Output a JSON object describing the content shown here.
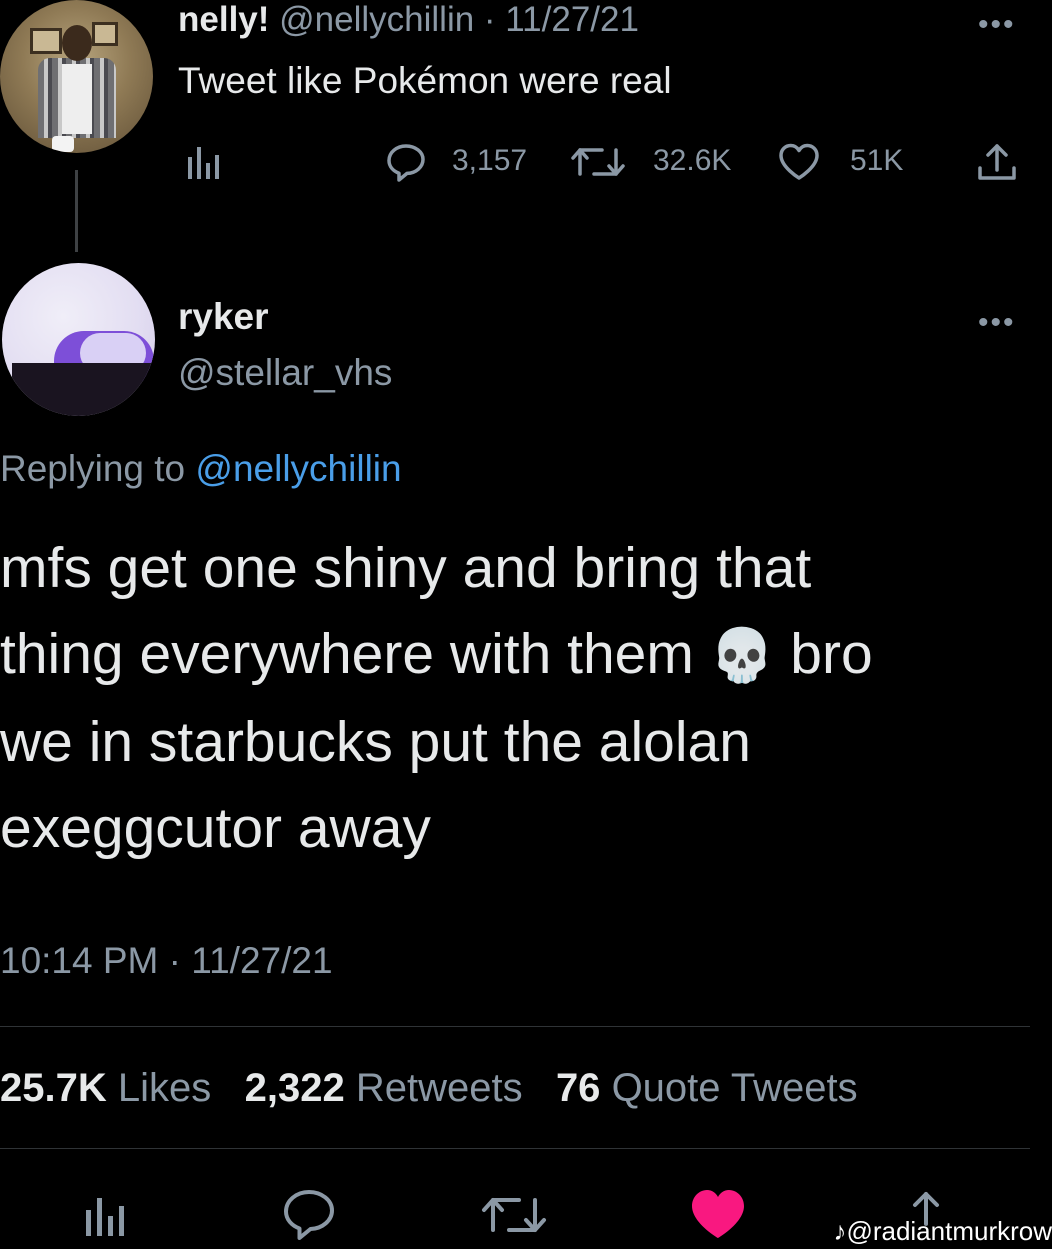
{
  "parent_tweet": {
    "display_name": "nelly!",
    "handle_date": "@nellychillin · 11/27/21",
    "text": "Tweet like Pokémon were real",
    "replies": "3,157",
    "retweets": "32.6K",
    "likes": "51K"
  },
  "reply_tweet": {
    "display_name": "ryker",
    "handle": "@stellar_vhs",
    "replying_prefix": "Replying to",
    "replying_handle": "@nellychillin",
    "text_lines": [
      "mfs get one shiny and bring that",
      "thing everywhere with them",
      "bro",
      "we in starbucks put the alolan",
      "exeggcutor away"
    ],
    "skull_emoji": "💀",
    "timestamp": "10:14 PM · 11/27/21",
    "stats": {
      "likes_count": "25.7K",
      "likes_label": "Likes",
      "retweets_count": "2,322",
      "retweets_label": "Retweets",
      "quotes_count": "76",
      "quotes_label": "Quote Tweets"
    }
  },
  "watermark": {
    "logo": "♪",
    "handle": "@radiantmurkrow"
  },
  "colors": {
    "background": "#000000",
    "text": "#e7e9ea",
    "secondary": "#8b98a5",
    "link": "#4a9ee8",
    "like_active": "#f91880",
    "divider": "#2f3336"
  },
  "icons": {
    "analytics": "analytics-icon",
    "reply": "reply-icon",
    "retweet": "retweet-icon",
    "like": "heart-icon",
    "share": "share-icon",
    "more": "more-icon"
  }
}
